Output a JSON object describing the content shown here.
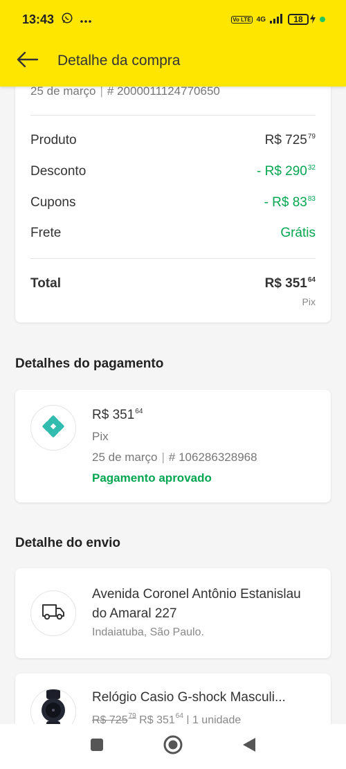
{
  "status_bar": {
    "time": "13:43",
    "network": "4G",
    "volte": "Vo LTE",
    "battery": "18"
  },
  "app_bar": {
    "title": "Detalhe da compra"
  },
  "summary": {
    "date": "25 de março",
    "order_number": "# 2000011124770650",
    "rows": [
      {
        "label": "Produto",
        "prefix": "",
        "amount": "R$ 725",
        "cents": "79"
      },
      {
        "label": "Desconto",
        "prefix": "",
        "amount": "- R$ 290",
        "cents": "32"
      },
      {
        "label": "Cupons",
        "prefix": "",
        "amount": "- R$ 83",
        "cents": "83"
      },
      {
        "label": "Frete",
        "value": "Grátis"
      }
    ],
    "total": {
      "label": "Total",
      "amount": "R$ 351",
      "cents": "64",
      "method": "Pix"
    }
  },
  "payment": {
    "section_title": "Detalhes do pagamento",
    "amount": "R$ 351",
    "cents": "64",
    "method": "Pix",
    "date": "25 de março",
    "transaction": "# 106286328968",
    "status": "Pagamento aprovado"
  },
  "shipping": {
    "section_title": "Detalhe do envio",
    "address": "Avenida Coronel Antônio Estanislau do Amaral 227",
    "city": "Indaiatuba, São Paulo."
  },
  "product": {
    "title": "Relógio Casio G-shock Masculi...",
    "old_price": "R$ 725",
    "old_cents": "79",
    "price": "R$ 351",
    "price_cents": "64",
    "quantity": "| 1 unidade"
  },
  "colors": {
    "brand_yellow": "#ffe600",
    "green": "#00a650",
    "pix_teal": "#32bcad"
  },
  "icons": {
    "back": "arrow-left-icon",
    "pix": "pix-icon",
    "truck": "truck-icon",
    "nav_recents": "square-icon",
    "nav_home": "circle-icon",
    "nav_back": "triangle-back-icon"
  }
}
